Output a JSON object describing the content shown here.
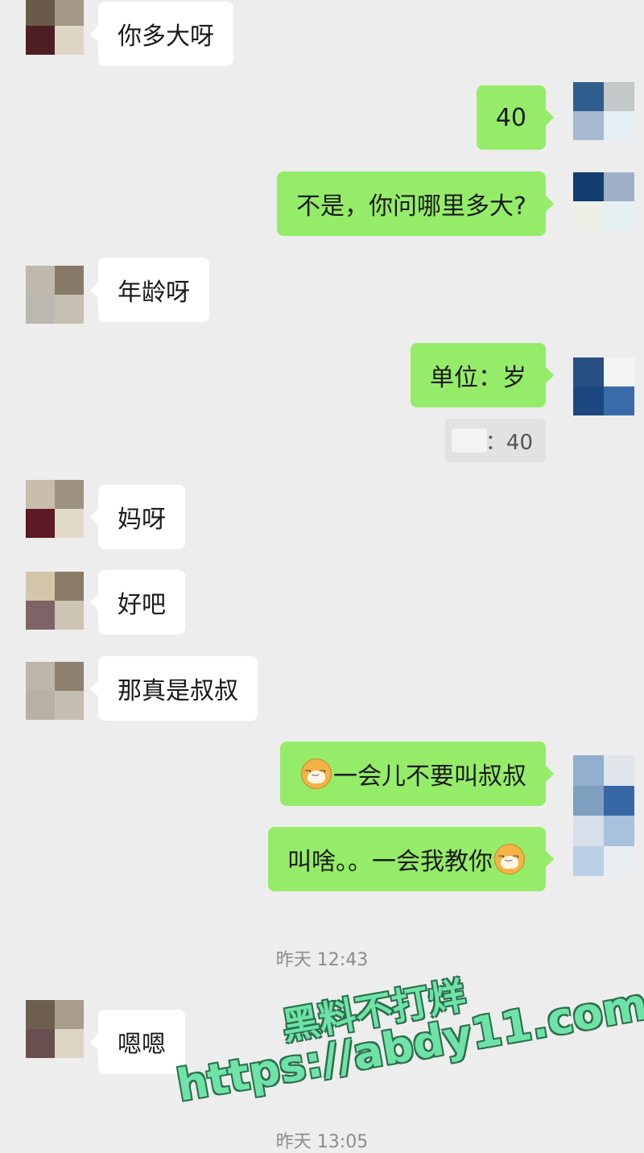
{
  "messages": [
    {
      "side": "in",
      "text": "你多大呀"
    },
    {
      "side": "out",
      "text": "40"
    },
    {
      "side": "out",
      "text": "不是，你问哪里多大?"
    },
    {
      "side": "in",
      "text": "年龄呀"
    },
    {
      "side": "out",
      "text": "单位：岁"
    },
    {
      "quote": "：40"
    },
    {
      "side": "in",
      "text": "妈呀"
    },
    {
      "side": "in",
      "text": "好吧"
    },
    {
      "side": "in",
      "text": "那真是叔叔"
    },
    {
      "side": "out",
      "text": "一会儿不要叫叔叔",
      "emoji_before": "doge-emoji"
    },
    {
      "side": "out",
      "text": "叫啥。。一会我教你",
      "emoji_after": "doge-emoji"
    },
    {
      "time": "昨天 12:43"
    },
    {
      "side": "in",
      "text": "嗯嗯"
    },
    {
      "time": "昨天 13:05"
    }
  ],
  "watermark": {
    "line1": "黑料不打烊",
    "line2": "https://abdy11.com"
  },
  "colors": {
    "background": "#ededed",
    "incoming_bubble": "#ffffff",
    "outgoing_bubble": "#95ec69",
    "watermark": "#6fe3a7"
  }
}
